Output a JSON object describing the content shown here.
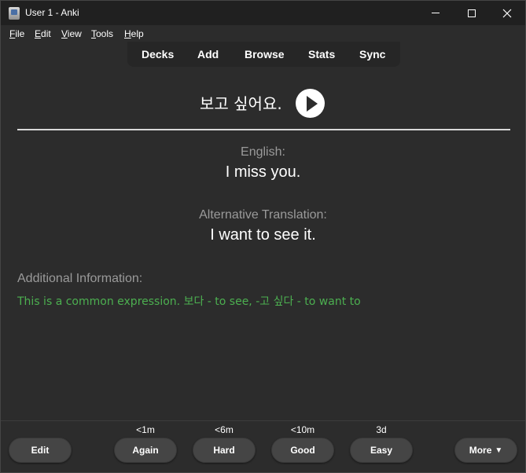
{
  "window": {
    "title": "User 1 - Anki"
  },
  "menu": {
    "items": [
      {
        "first": "F",
        "rest": "ile"
      },
      {
        "first": "E",
        "rest": "dit"
      },
      {
        "first": "V",
        "rest": "iew"
      },
      {
        "first": "T",
        "rest": "ools"
      },
      {
        "first": "H",
        "rest": "elp"
      }
    ]
  },
  "toolbar": {
    "decks": "Decks",
    "add": "Add",
    "browse": "Browse",
    "stats": "Stats",
    "sync": "Sync"
  },
  "card": {
    "front": "보고 싶어요.",
    "play_icon": "play-icon",
    "english_label": "English:",
    "english_value": "I miss you.",
    "alt_label": "Alternative Translation:",
    "alt_value": "I want to see it.",
    "additional_label": "Additional Information:",
    "additional_text": "This is a common expression. 보다 - to see, -고 싶다 - to want to",
    "additional_color": "#4caf50"
  },
  "bottom": {
    "edit_label": "Edit",
    "again": {
      "interval": "<1m",
      "label": "Again"
    },
    "hard": {
      "interval": "<6m",
      "label": "Hard"
    },
    "good": {
      "interval": "<10m",
      "label": "Good"
    },
    "easy": {
      "interval": "3d",
      "label": "Easy"
    },
    "more_label": "More",
    "more_arrow": "▼"
  }
}
